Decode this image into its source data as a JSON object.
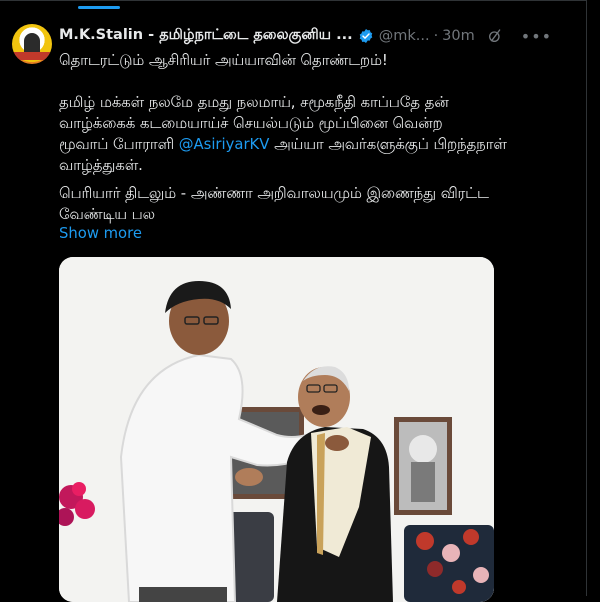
{
  "tweet": {
    "author_name": "M.K.Stalin - தமிழ்நாட்டை தலைகுனிய ...",
    "handle": "@mk...",
    "separator": "·",
    "time": "30m",
    "line1": "தொடரட்டும் ஆசிரியர் அய்யாவின் தொண்டறம்!",
    "p2_line1": "தமிழ் மக்கள் நலமே தமது நலமாய், சமூகநீதி காப்பதே தன்",
    "p2_line2": "வாழ்க்கைக் கடமையாய்ச் செயல்படும் மூப்பினை வென்ற",
    "p2_line3_pre": "மூவாப் போராளி ",
    "mention": "@AsiriyarKV",
    "p2_line3_post": " அய்யா அவர்களுக்குப் பிறந்தநாள்",
    "p2_line4": "வாழ்த்துகள்.",
    "p3_line1": "பெரியார் திடலும் - அண்ணா அறிவாலயமும் இணைந்து விரட்ட",
    "p3_line2": "வேண்டிய பல",
    "show_more": "Show more"
  },
  "icons": {
    "verified": "verified-badge-icon",
    "grok": "grok-icon",
    "more": "more-options-icon"
  },
  "colors": {
    "background": "#000000",
    "text": "#e7e9ea",
    "muted": "#71767b",
    "accent": "#1d9bf0"
  }
}
